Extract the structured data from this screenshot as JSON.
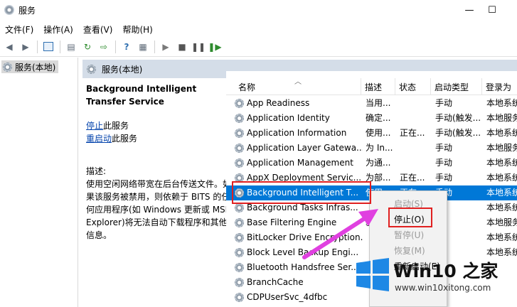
{
  "window": {
    "title": "服务",
    "minimize": "—",
    "maximize": "☐"
  },
  "menu": [
    "文件(F)",
    "操作(A)",
    "查看(V)",
    "帮助(H)"
  ],
  "tree": {
    "root_label": "服务(本地)"
  },
  "main_header": {
    "title": "服务(本地)"
  },
  "details": {
    "service_title": "Background Intelligent Transfer Service",
    "stop_link": "停止",
    "stop_suffix": "此服务",
    "restart_link": "重启动",
    "restart_suffix": "此服务",
    "desc_label": "描述:",
    "desc_text": "使用空闲网络带宽在后台传送文件。如果该服务被禁用，则依赖于 BITS 的任何应用程序(如 Windows 更新或 MSN Explorer)将无法自动下载程序和其他信息。"
  },
  "table": {
    "columns": [
      "名称",
      "描述",
      "状态",
      "启动类型",
      "登录为"
    ],
    "rows": [
      {
        "name": "App Readiness",
        "desc": "当用...",
        "status": "",
        "startup": "手动",
        "logon": "本地系统"
      },
      {
        "name": "Application Identity",
        "desc": "确定...",
        "status": "",
        "startup": "手动(触发...",
        "logon": "本地服务"
      },
      {
        "name": "Application Information",
        "desc": "使用...",
        "status": "正在...",
        "startup": "手动(触发...",
        "logon": "本地系统"
      },
      {
        "name": "Application Layer Gatewa...",
        "desc": "为 In...",
        "status": "",
        "startup": "手动",
        "logon": "本地服务"
      },
      {
        "name": "Application Management",
        "desc": "为通...",
        "status": "",
        "startup": "手动",
        "logon": "本地系统"
      },
      {
        "name": "AppX Deployment Servic...",
        "desc": "为部...",
        "status": "正在...",
        "startup": "手动",
        "logon": "本地系统"
      },
      {
        "name": "Background Intelligent T...",
        "desc": "使用...",
        "status": "正在...",
        "startup": "手动",
        "logon": "本地系统",
        "selected": true
      },
      {
        "name": "Background Tasks Infras...",
        "desc": "",
        "status": "",
        "startup": "",
        "logon": "本地系统"
      },
      {
        "name": "Base Filtering Engine",
        "desc": "基...",
        "status": "",
        "startup": "",
        "logon": "本地服务"
      },
      {
        "name": "BitLocker Drive Encryption...",
        "desc": "",
        "status": "",
        "startup": "",
        "logon": "本地系统"
      },
      {
        "name": "Block Level Backup Engi...",
        "desc": "",
        "status": "",
        "startup": "",
        "logon": "本地系统"
      },
      {
        "name": "Bluetooth Handsfree Ser...",
        "desc": "",
        "status": "",
        "startup": "",
        "logon": ""
      },
      {
        "name": "BranchCache",
        "desc": "",
        "status": "",
        "startup": "",
        "logon": ""
      },
      {
        "name": "CDPUserSvc_4dfbc",
        "desc": "",
        "status": "",
        "startup": "",
        "logon": ""
      }
    ]
  },
  "context_menu": {
    "items": [
      {
        "label": "启动(S)",
        "disabled": true
      },
      {
        "label": "停止(O)",
        "disabled": false
      },
      {
        "label": "暂停(U)",
        "disabled": true
      },
      {
        "label": "恢复(M)",
        "disabled": true
      },
      {
        "label": "重新启动(E)",
        "disabled": false
      }
    ]
  },
  "watermark": {
    "brand": "Win10 之家",
    "url": "www.win10xitong.com"
  },
  "colors": {
    "selection": "#0078d7",
    "highlight_box": "#e02020",
    "arrow": "#e040e0",
    "logo": "#1e88e5"
  }
}
